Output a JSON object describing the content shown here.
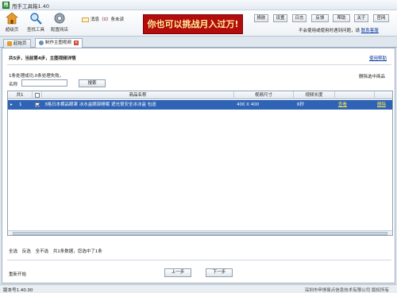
{
  "window": {
    "title": "甩手工具箱1.40",
    "app_icon_letter": "甩"
  },
  "toolbar": {
    "tools": [
      {
        "label": "超级页",
        "icon": "home-icon"
      },
      {
        "label": "查找工具",
        "icon": "search-tool-icon"
      },
      {
        "label": "配置网店",
        "icon": "gear-icon"
      }
    ],
    "message_prefix": "消息（",
    "message_count": "0",
    "message_suffix": "）条未读",
    "banner": "你也可以挑战月入过万!",
    "buttons": [
      "换肤",
      "设置",
      "日志",
      "反馈",
      "帮助",
      "关于",
      "官网"
    ],
    "contact_text": "不会使用或使用时遇到问题，请",
    "contact_link": "联系客服"
  },
  "tabs": [
    {
      "label": "起始页",
      "active": false
    },
    {
      "label": "制作主图视频",
      "active": true
    }
  ],
  "panel": {
    "step_title": "共5步，当前第4步，主图视频详情",
    "help_link": "使用帮助",
    "status_line": "1条处理成功,0条处理失败。",
    "clear_link": "删除选中商品",
    "name_label": "名称",
    "name_value": "",
    "search_button": "搜索"
  },
  "grid": {
    "columns": [
      "共1",
      "",
      "商品名称",
      "视频尺寸",
      "视频长度",
      "",
      ""
    ],
    "rows": [
      {
        "index": "1",
        "checked": true,
        "name": "3格日本横品眼罩 冰水盒眼部睡眠 遮光很安全冰冰盒 包送",
        "size": "400 X 400",
        "length": "6秒",
        "view": "查看",
        "delete": "删除"
      }
    ]
  },
  "footer": {
    "select_all": "全选",
    "invert": "反选",
    "select_none": "全不选",
    "summary": "共1条数据，您选中了1条",
    "restart": "重新开始",
    "prev": "上一步",
    "next": "下一步"
  },
  "statusbar": {
    "version": "版本号1.40.00",
    "company": "深圳市甲馈易点信息技术有限公司 版权所有"
  },
  "colors": {
    "selected_row": "#2f63b6",
    "banner_bg": "#b20c0c",
    "banner_text": "#ffef9a",
    "message_count": "#d10000"
  }
}
